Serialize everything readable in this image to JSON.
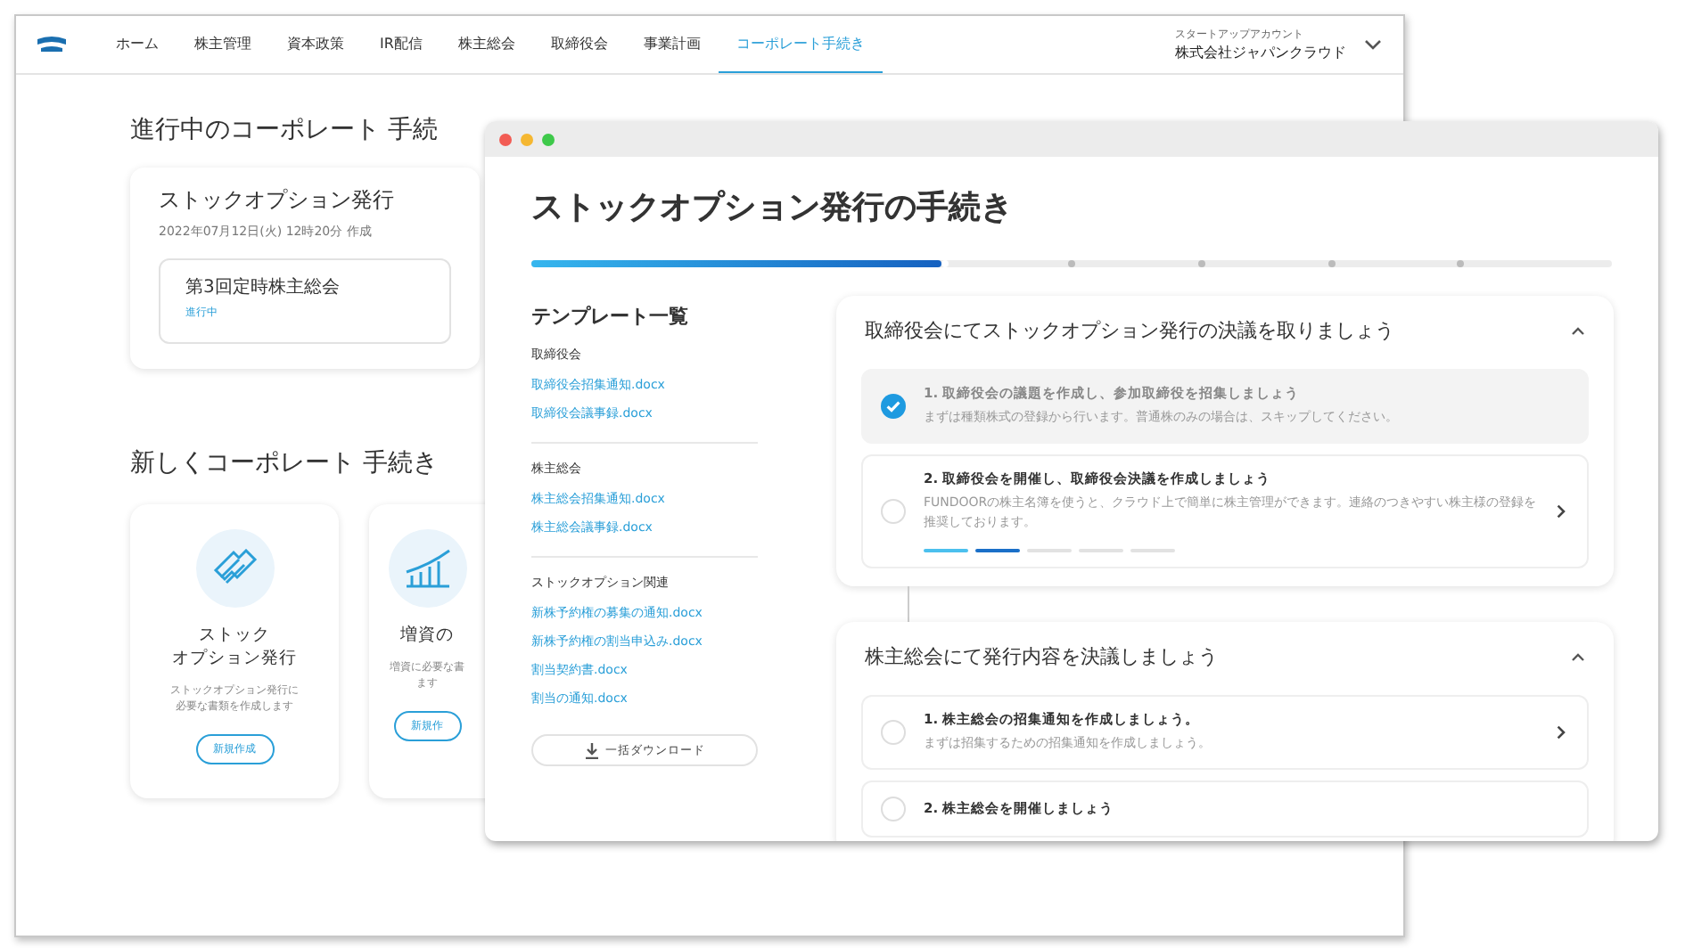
{
  "back_window": {
    "nav": {
      "items": [
        {
          "label": "ホーム",
          "selected": false
        },
        {
          "label": "株主管理",
          "selected": false
        },
        {
          "label": "資本政策",
          "selected": false
        },
        {
          "label": "IR配信",
          "selected": false
        },
        {
          "label": "株主総会",
          "selected": false
        },
        {
          "label": "取締役会",
          "selected": false
        },
        {
          "label": "事業計画",
          "selected": false
        },
        {
          "label": "コーポレート手続き",
          "selected": true
        }
      ],
      "account": {
        "caption": "スタートアップアカウント",
        "name": "株式会社ジャパンクラウド"
      }
    },
    "in_progress": {
      "heading": "進行中のコーポレート 手続",
      "card": {
        "title": "ストックオプション発行",
        "date": "2022年07月12日(火) 12時20分 作成",
        "item": {
          "title": "第3回定時株主総会",
          "status": "進行中"
        }
      }
    },
    "new": {
      "heading": "新しくコーポレート 手続き",
      "cards": [
        {
          "kind": "ticket",
          "title_lines": [
            "ストック",
            "オプション発行"
          ],
          "description_lines": [
            "ストックオプション発行に",
            "必要な書類を作成します"
          ],
          "button": "新規作成"
        },
        {
          "kind": "chart",
          "title_lines": [
            "増資の"
          ],
          "description_lines": [
            "増資に必要な書",
            "ます"
          ],
          "button": "新規作"
        }
      ]
    }
  },
  "front_window": {
    "title": "ストックオプション発行の手続き",
    "progress": {
      "level": 0.38
    },
    "templates": {
      "heading": "テンプレート一覧",
      "groups": [
        {
          "name": "取締役会",
          "files": [
            "取締役会招集通知.docx",
            "取締役会議事録.docx"
          ]
        },
        {
          "name": "株主総会",
          "files": [
            "株主総会招集通知.docx",
            "株主総会議事録.docx"
          ]
        },
        {
          "name": "ストックオプション関連",
          "files": [
            "新株予約権の募集の通知.docx",
            "新株予約権の割当申込み.docx",
            "割当契約書.docx",
            "割当の通知.docx"
          ]
        }
      ],
      "download_button": "一括ダウンロード"
    },
    "sections": [
      {
        "title": "取締役会にてストックオプション発行の決議を取りましょう",
        "expanded": true,
        "steps": [
          {
            "title": "1. 取締役会の議題を作成し、参加取締役を招集しましょう",
            "description": "まずは種類株式の登録から行います。普通株のみの場合は、スキップしてください。",
            "checked": true
          },
          {
            "title": "2. 取締役会を開催し、取締役会決議を作成しましょう",
            "description": "FUNDOORの株主名簿を使うと、クラウド上で簡単に株主管理ができます。連絡のつきやすい株主様の登録を推奨しております。",
            "checked": false,
            "segments": [
              {
                "done": true,
                "current": false
              },
              {
                "done": true,
                "current": true
              },
              {
                "done": false,
                "current": false
              },
              {
                "done": false,
                "current": false
              },
              {
                "done": false,
                "current": false
              }
            ]
          }
        ]
      },
      {
        "title": "株主総会にて発行内容を決議しましょう",
        "expanded": true,
        "steps": [
          {
            "title": "1. 株主総会の招集通知を作成しましょう。",
            "description": "まずは招集するための招集通知を作成しましょう。",
            "checked": false
          },
          {
            "title": "2. 株主総会を開催しましょう",
            "checked": false
          }
        ]
      }
    ]
  }
}
